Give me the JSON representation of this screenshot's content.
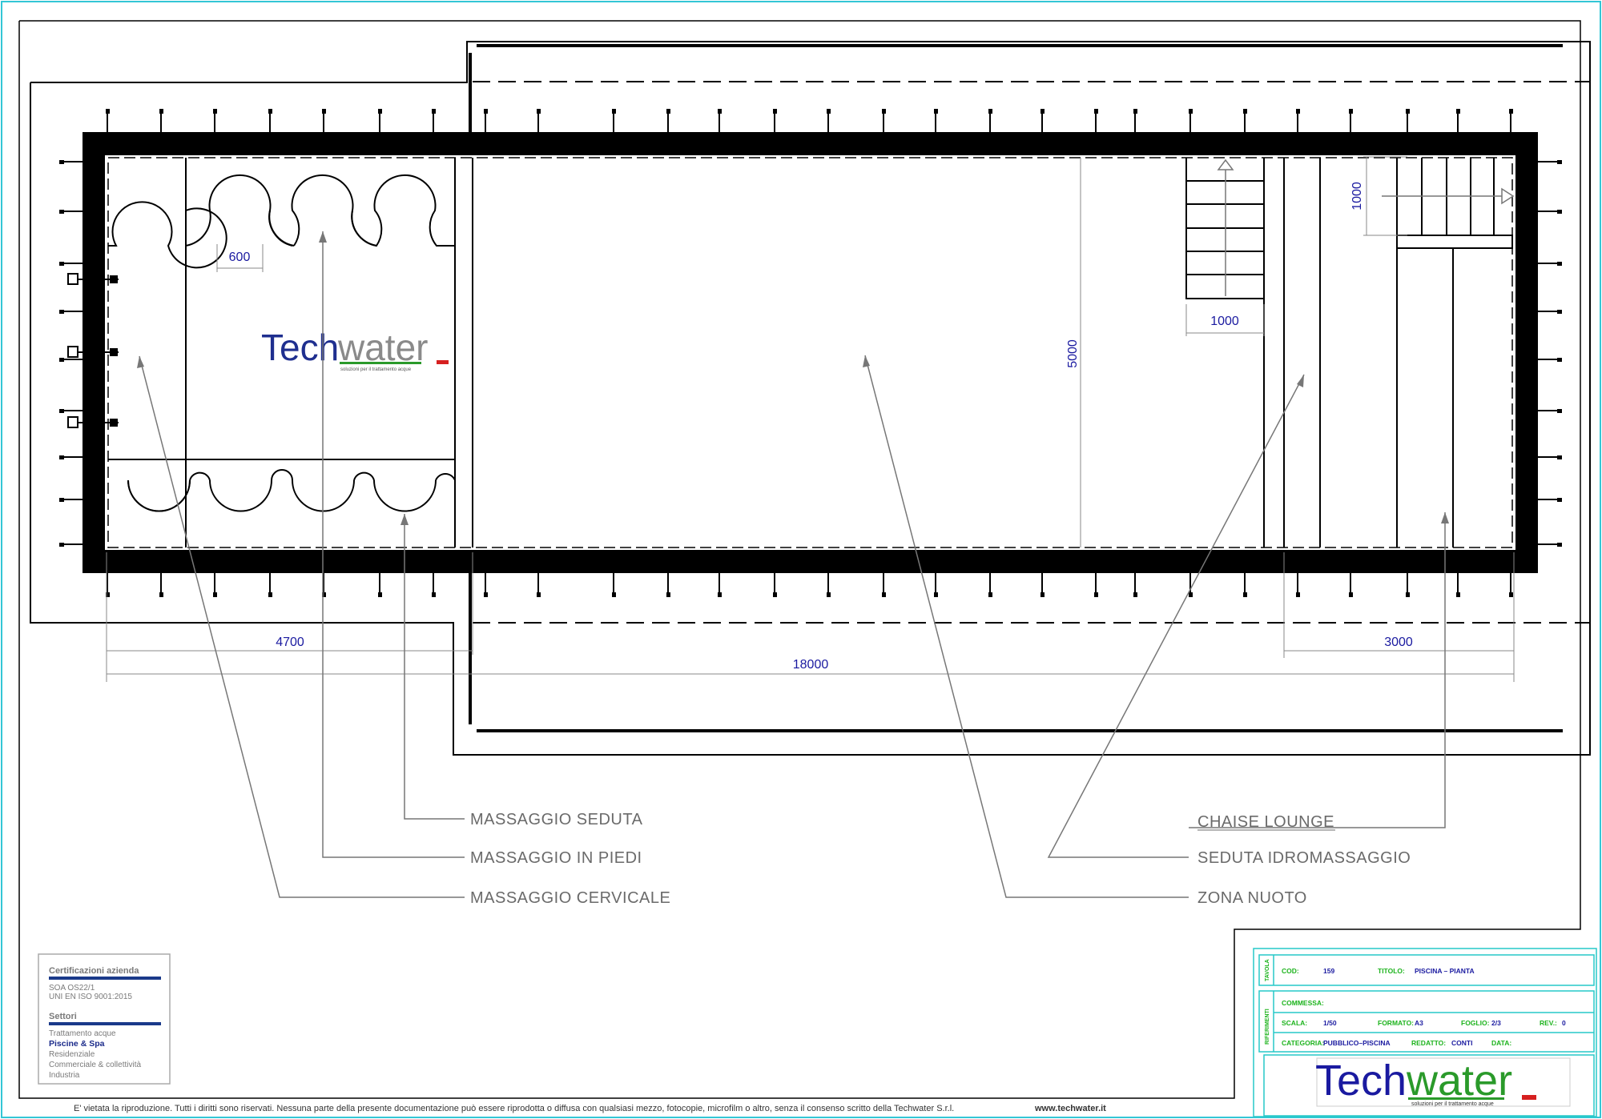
{
  "dimensions": {
    "d600": "600",
    "d1000_stair": "1000",
    "d1000_vertical": "1000",
    "d5000": "5000",
    "d4700": "4700",
    "d18000": "18000",
    "d3000": "3000"
  },
  "callouts": {
    "massaggio_seduta": "MASSAGGIO SEDUTA",
    "massaggio_in_piedi": "MASSAGGIO IN PIEDI",
    "massaggio_cervicale": "MASSAGGIO CERVICALE",
    "chaise_lounge": "CHAISE LOUNGE",
    "seduta_idromassaggio": "SEDUTA IDROMASSAGGIO",
    "zona_nuoto": "ZONA NUOTO"
  },
  "logo": {
    "part1": "Tech",
    "part2": "water",
    "tagline": "soluzioni per il trattamento acque"
  },
  "certifications": {
    "title": "Certificazioni azienda",
    "items": [
      "SOA OS22/1",
      "UNI EN ISO 9001:2015"
    ],
    "sectors_title": "Settori",
    "sectors": [
      "Trattamento acque",
      "Piscine & Spa",
      "Residenziale",
      "Commerciale & collettività",
      "Industria"
    ]
  },
  "title_block": {
    "side_tavola": "TAVOLA",
    "side_riferimenti": "RIFERIMENTI",
    "cod_label": "COD:",
    "cod_value": "159",
    "titolo_label": "TITOLO:",
    "titolo_value": "PISCINA  –  PIANTA",
    "commessa_label": "COMMESSA:",
    "scala_label": "SCALA:",
    "scala_value": "1/50",
    "formato_label": "FORMATO:",
    "formato_value": "A3",
    "foglio_label": "FOGLIO:",
    "foglio_value": "2/3",
    "rev_label": "REV.:",
    "rev_value": "0",
    "categoria_label": "CATEGORIA:",
    "categoria_value": "PUBBLICO–PISCINA",
    "redatto_label": "REDATTO:",
    "redatto_value": "CONTI",
    "data_label": "DATA:"
  },
  "footer": {
    "disclaimer": "E' vietata la riproduzione. Tutti i diritti sono riservati. Nessuna parte della presente documentazione può essere riprodotta o diffusa con qualsiasi mezzo, fotocopie, microfilm o altro, senza il consenso scritto della Techwater S.r.l.",
    "website": "www.techwater.it"
  },
  "colors": {
    "dimension_text": "#1a1aa0",
    "callout_text": "#6a6a6a",
    "title_block_border": "#27c9c9",
    "title_block_label": "#1db31d",
    "logo_blue": "#1f2f8f",
    "logo_grey": "#8a8a8a",
    "accent_green": "#2a9a2a",
    "accent_red": "#d62020"
  }
}
